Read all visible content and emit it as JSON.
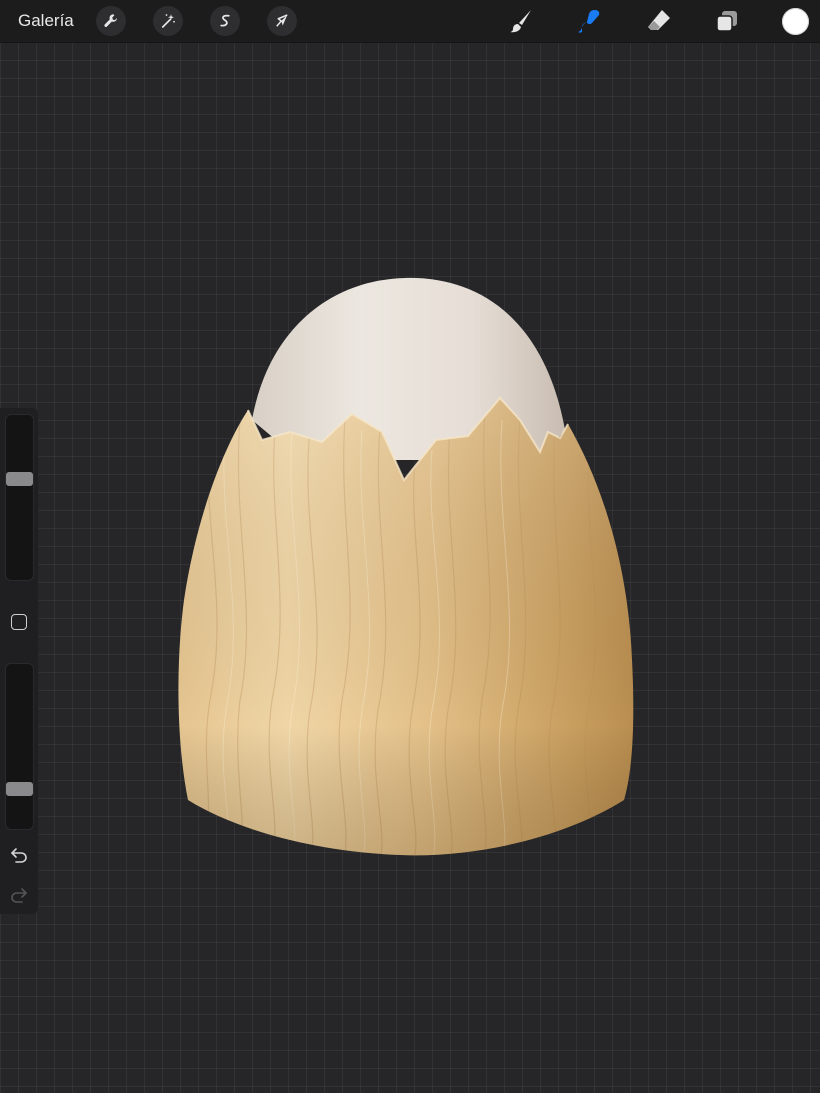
{
  "topbar": {
    "gallery_label": "Galería",
    "left_tools": [
      "wrench-icon",
      "magic-wand-icon",
      "selection-icon",
      "transform-arrow-icon"
    ],
    "right_tools": [
      "brush-icon",
      "smudge-icon",
      "eraser-icon",
      "layers-icon"
    ],
    "active_tool": "smudge-icon",
    "active_color": "#ffffff",
    "accent_color": "#1a7cf5"
  },
  "sidebar": {
    "brush_size_level": 0.38,
    "opacity_level": 0.78,
    "buttons": [
      "modify-square-icon",
      "undo-icon",
      "redo-icon"
    ]
  },
  "canvas": {
    "artwork": "egg-with-wooden-cracked-shell",
    "background_color": "#262628",
    "shell_color": "#d9b47a",
    "egg_color": "#e7e1d9"
  }
}
